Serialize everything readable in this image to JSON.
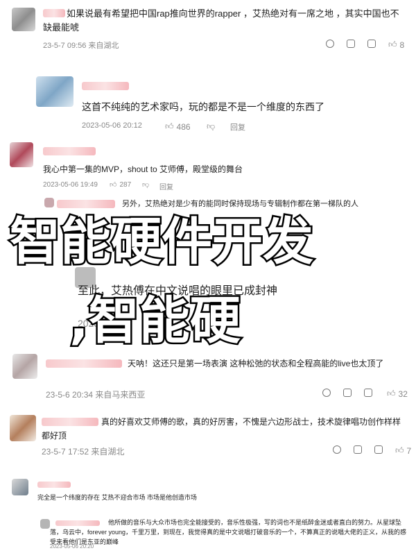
{
  "comments": [
    {
      "text": "如果说最有希望把中国rap推向世界的rapper ，艾热绝对有一席之地 ，其实中国也不缺最能唬",
      "date": "23-5-7 09:56 来自湖北",
      "likes": "8"
    },
    {
      "text": "这首不纯纯的艺术家吗，玩的都是不是一个维度的东西了",
      "date": "2023-05-06 20:12",
      "likes": "486",
      "reply": "回复"
    },
    {
      "text": "我心中第一集的MVP，shout to 艾师傅，殿堂级的舞台",
      "date": "2023-05-06 19:49",
      "likes": "287",
      "reply": "回复"
    },
    {
      "text": "另外，艾热绝对是少有的能同时保持现场与专辑制作都在第一梯队的人",
      "date": "",
      "likes": "",
      "reply": ""
    },
    {
      "text": "至此，艾热傅在中文说唱的眼里已成封神",
      "date": "2023-05-06",
      "likes": ""
    },
    {
      "text": "天呐！这还只是第一场表演 这种松弛的状态和全程高能的live也太顶了",
      "date": "23-5-6 20:34 来自马来西亚",
      "likes": "32"
    },
    {
      "text": "真的好喜欢艾师傅的歌，真的好厉害，不愧是六边形战士，技术旋律唱功创作样样都好顶",
      "date": "23-5-7 17:52 来自湖北",
      "likes": "7"
    },
    {
      "text": "完全是一个纬度的存在 艾热不迎合市场 市场是他创造市场",
      "date": "",
      "likes": ""
    },
    {
      "text": "他所做的音乐与大众市场也完全能接受的，音乐性极强，写的词也不是纸醉金迷或者直白的努力。从星球坠落，乌云中，forever young，千里万里，到现在，我觉得真的是中文说唱打破音乐的一个，不算真正的说唱大佬的正义，从我的感受来看他们是东亚的巅峰",
      "date": "2023-05-06 20:20",
      "likes": "",
      "reply": ""
    }
  ],
  "overlay": {
    "line1": "智能硬件开发",
    "line2": ",智能硬"
  },
  "icons": {
    "flag": "flag-icon",
    "share": "share-icon",
    "comment": "comment-icon",
    "like": "like-icon"
  }
}
